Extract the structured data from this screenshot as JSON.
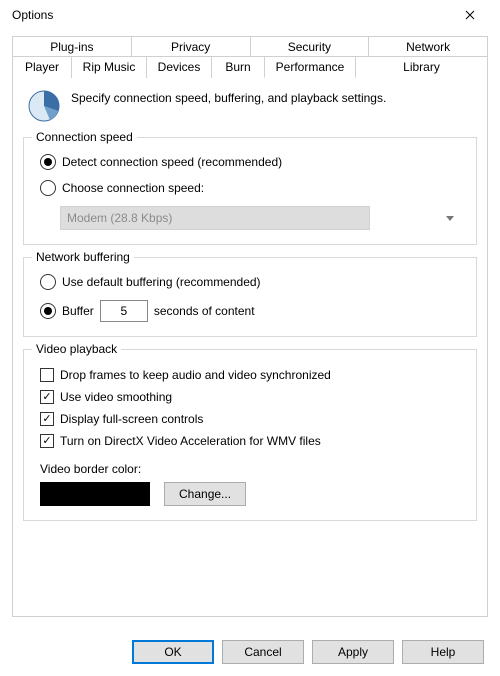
{
  "window": {
    "title": "Options"
  },
  "tabs_top": [
    "Plug-ins",
    "Privacy",
    "Security",
    "Network"
  ],
  "tabs_bottom": [
    {
      "label": "Player",
      "w": 60
    },
    {
      "label": "Rip Music",
      "w": 76
    },
    {
      "label": "Devices",
      "w": 66
    },
    {
      "label": "Burn",
      "w": 54
    },
    {
      "label": "Performance",
      "w": 92
    },
    {
      "label": "Library",
      "w": 60
    }
  ],
  "active_tab": "Performance",
  "header": "Specify connection speed, buffering, and playback settings.",
  "conn": {
    "legend": "Connection speed",
    "detect": "Detect connection speed (recommended)",
    "choose": "Choose connection speed:",
    "combo": "Modem (28.8 Kbps)"
  },
  "netbuf": {
    "legend": "Network buffering",
    "default": "Use default buffering (recommended)",
    "buffer": "Buffer",
    "value": "5",
    "suffix": "seconds of content"
  },
  "video": {
    "legend": "Video playback",
    "drop": "Drop frames to keep audio and video synchronized",
    "smooth": "Use video smoothing",
    "fullscreen": "Display full-screen controls",
    "dx": "Turn on DirectX Video Acceleration for WMV files",
    "border_label": "Video border color:",
    "change": "Change...",
    "border_color": "#000000"
  },
  "buttons": {
    "ok": "OK",
    "cancel": "Cancel",
    "apply": "Apply",
    "help": "Help"
  }
}
